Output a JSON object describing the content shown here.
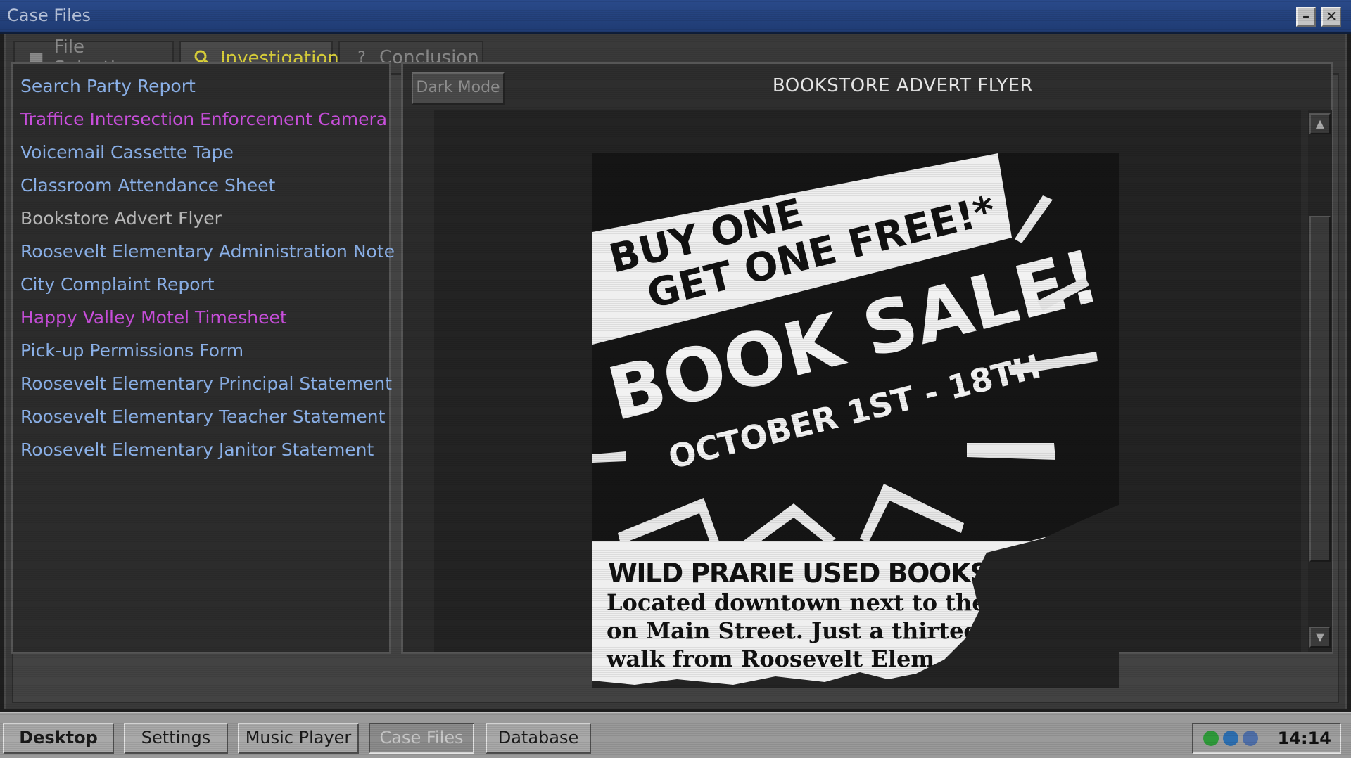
{
  "window": {
    "title": "Case Files",
    "minimize_label": "–",
    "close_label": "✕"
  },
  "tabs": [
    {
      "label": "File Selection",
      "icon": "folder-icon",
      "glyph": "▆"
    },
    {
      "label": "Investigation",
      "icon": "search-icon",
      "glyph": "🔍"
    },
    {
      "label": "Conclusion",
      "icon": "question-icon",
      "glyph": "?"
    }
  ],
  "files": [
    {
      "label": "Search Party Report"
    },
    {
      "label": "Traffice Intersection Enforcement Camera"
    },
    {
      "label": "Voicemail Cassette Tape"
    },
    {
      "label": "Classroom Attendance Sheet"
    },
    {
      "label": "Bookstore Advert Flyer"
    },
    {
      "label": "Roosevelt Elementary Administration Note"
    },
    {
      "label": "City Complaint Report"
    },
    {
      "label": "Happy Valley Motel Timesheet"
    },
    {
      "label": "Pick-up Permissions Form"
    },
    {
      "label": "Roosevelt Elementary Principal Statement"
    },
    {
      "label": "Roosevelt Elementary Teacher Statement"
    },
    {
      "label": "Roosevelt Elementary Janitor Statement"
    }
  ],
  "viewer": {
    "dark_mode_label": "Dark Mode",
    "doc_title": "BOOKSTORE ADVERT FLYER",
    "scroll_up": "▲",
    "scroll_down": "▼"
  },
  "flyer": {
    "banner_line1": "BUY ONE",
    "banner_line2": "GET ONE FREE!*",
    "headline": "BOOK SALE!",
    "dates": "OCTOBER 1ST - 18TH",
    "store_name": "WILD PRARIE USED BOOKSTORE",
    "body_line1": "Located downtown next to the",
    "body_line2": "on Main Street. Just a thirteen",
    "body_line3": "walk from Roosevelt Elem"
  },
  "colors": {
    "active_tab": "#ddd33a",
    "file_unviewed": "#8cb2ea",
    "file_viewed": "#c94fdc",
    "file_selected": "#b8b8b8"
  },
  "taskbar": {
    "buttons": [
      {
        "label": "Desktop"
      },
      {
        "label": "Settings"
      },
      {
        "label": "Music Player"
      },
      {
        "label": "Case Files"
      },
      {
        "label": "Database"
      }
    ],
    "clock": "14:14"
  }
}
